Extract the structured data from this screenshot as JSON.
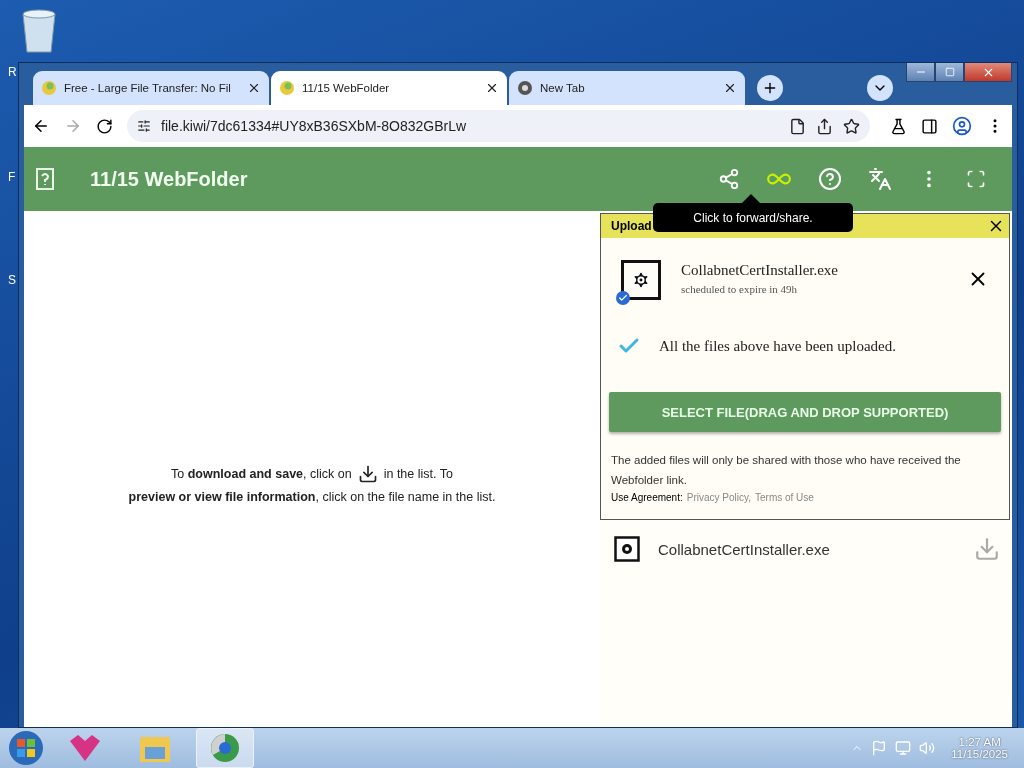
{
  "desktop": {
    "edge_labels": [
      "R",
      "F",
      "S"
    ]
  },
  "browser": {
    "tabs": [
      {
        "title": "Free - Large File Transfer: No Fil",
        "selected": false,
        "kind": "site"
      },
      {
        "title": "11/15 WebFolder",
        "selected": true,
        "kind": "site"
      },
      {
        "title": "New Tab",
        "selected": false,
        "kind": "newtab"
      }
    ],
    "url": "file.kiwi/7dc61334#UY8xB36SXbM-8O832GBrLw"
  },
  "app": {
    "title": "11/15 WebFolder",
    "tooltip": "Click to forward/share.",
    "hint": {
      "before": "To **download and save**, click on",
      "after": "in the list. To",
      "line2": "**preview or view file information**, click on the file name in the list."
    },
    "upload_panel": {
      "title": "Upload",
      "files": [
        {
          "name": "CollabnetCertInstaller.exe",
          "expiry": "scheduled to expire in 49h",
          "uploaded": true
        }
      ],
      "status": "All the files above have been uploaded.",
      "button": "SELECT FILE(DRAG AND DROP SUPPORTED)",
      "note": "The added files will only be shared with those who have received the Webfolder link.",
      "agreement_label": "Use Agreement:",
      "links": [
        "Privacy Policy,",
        "Terms of Use"
      ]
    },
    "file_list": [
      {
        "name": "CollabnetCertInstaller.exe"
      }
    ]
  },
  "taskbar": {
    "apps": [
      {
        "kind": "vpn",
        "selected": false
      },
      {
        "kind": "explorer",
        "selected": false
      },
      {
        "kind": "chrome",
        "selected": true
      }
    ],
    "time": "1:27 AM",
    "date": "11/15/2025"
  }
}
